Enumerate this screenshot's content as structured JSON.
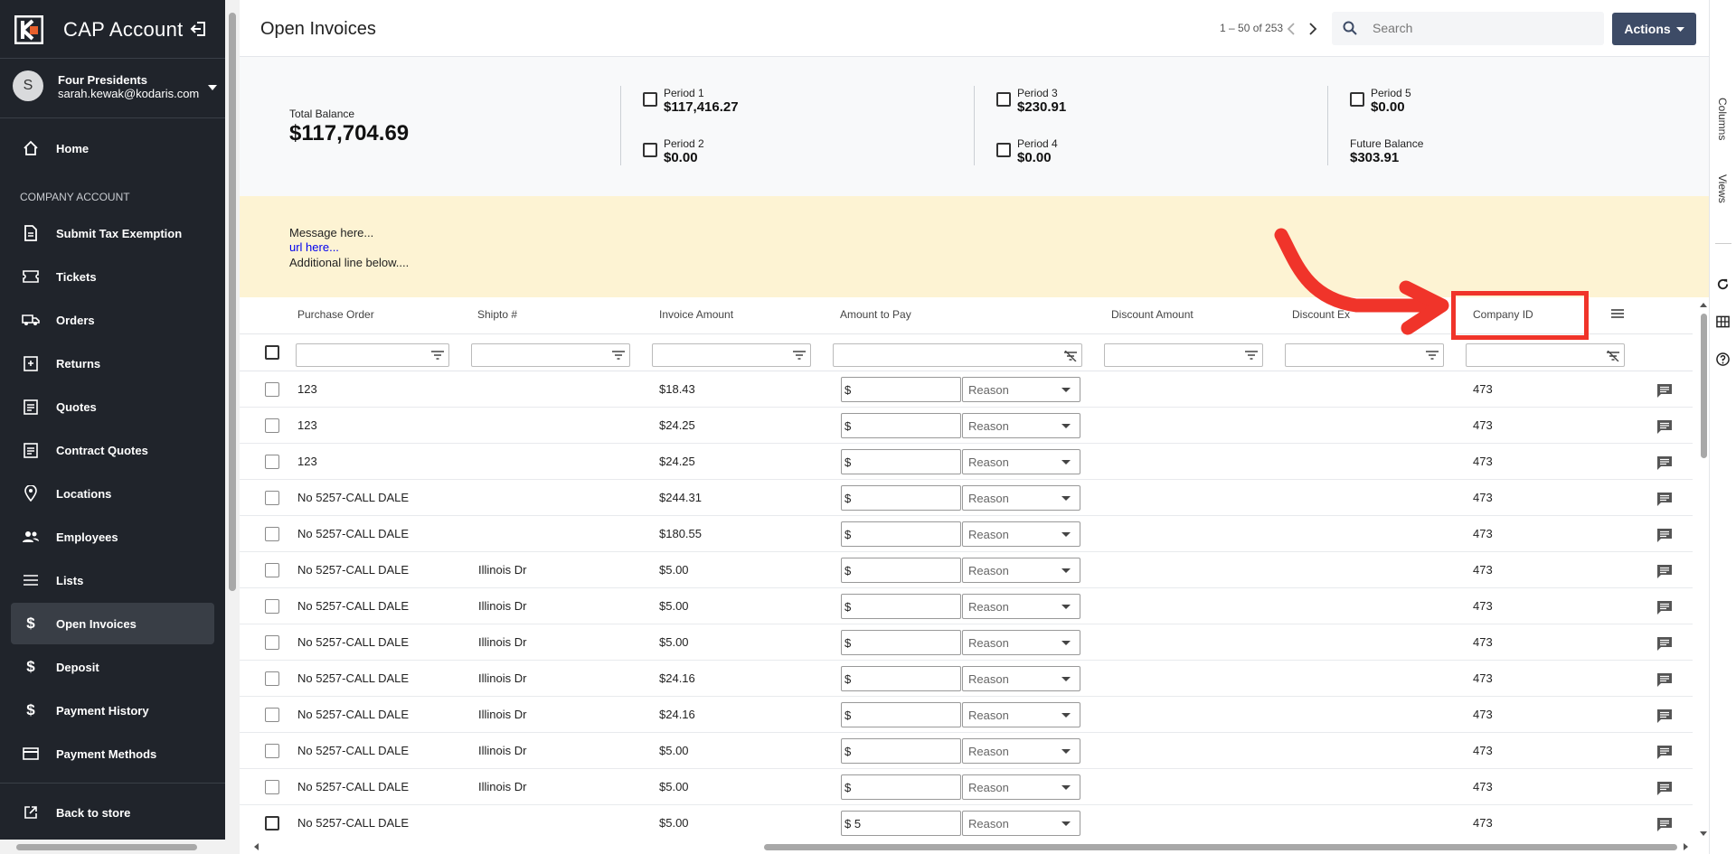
{
  "sidebar": {
    "brand": "CAP Account",
    "account": {
      "initial": "S",
      "name": "Four Presidents",
      "email": "sarah.kewak@kodaris.com"
    },
    "section_label": "COMPANY ACCOUNT",
    "items": [
      {
        "label": "Home",
        "icon": "home-icon"
      },
      {
        "label": "Submit Tax Exemption",
        "icon": "document-icon"
      },
      {
        "label": "Tickets",
        "icon": "ticket-icon"
      },
      {
        "label": "Orders",
        "icon": "truck-icon"
      },
      {
        "label": "Returns",
        "icon": "return-icon"
      },
      {
        "label": "Quotes",
        "icon": "quote-icon"
      },
      {
        "label": "Contract Quotes",
        "icon": "contract-icon"
      },
      {
        "label": "Locations",
        "icon": "location-icon"
      },
      {
        "label": "Employees",
        "icon": "employees-icon"
      },
      {
        "label": "Lists",
        "icon": "list-icon"
      },
      {
        "label": "Open Invoices",
        "icon": "dollar-icon",
        "active": true
      },
      {
        "label": "Deposit",
        "icon": "dollar-icon"
      },
      {
        "label": "Payment History",
        "icon": "dollar-icon"
      },
      {
        "label": "Payment Methods",
        "icon": "credit-card-icon"
      }
    ],
    "back_to_store": "Back to store"
  },
  "header": {
    "title": "Open Invoices",
    "pager": "1 – 50 of 253",
    "search_placeholder": "Search",
    "actions_label": "Actions"
  },
  "summary": {
    "total_label": "Total Balance",
    "total_value": "$117,704.69",
    "periods": [
      {
        "label": "Period 1",
        "value": "$117,416.27"
      },
      {
        "label": "Period 2",
        "value": "$0.00"
      },
      {
        "label": "Period 3",
        "value": "$230.91"
      },
      {
        "label": "Period 4",
        "value": "$0.00"
      },
      {
        "label": "Period 5",
        "value": "$0.00"
      }
    ],
    "future_label": "Future Balance",
    "future_value": "$303.91"
  },
  "banner": {
    "line1": "Message here...",
    "link": "url here...",
    "line3": "Additional line below...."
  },
  "right_panel": {
    "columns_tab": "Columns",
    "views_tab": "Views"
  },
  "grid": {
    "columns": [
      "Purchase Order",
      "Shipto #",
      "Invoice Amount",
      "Amount to Pay",
      "Discount Amount",
      "Discount Ex",
      "Company ID"
    ],
    "reason_placeholder": "Reason",
    "rows": [
      {
        "po": "123",
        "shipto": "",
        "amount": "$18.43",
        "pay": "$",
        "company": "473"
      },
      {
        "po": "123",
        "shipto": "",
        "amount": "$24.25",
        "pay": "$",
        "company": "473"
      },
      {
        "po": "123",
        "shipto": "",
        "amount": "$24.25",
        "pay": "$",
        "company": "473"
      },
      {
        "po": "No 5257-CALL DALE",
        "shipto": "",
        "amount": "$244.31",
        "pay": "$",
        "company": "473"
      },
      {
        "po": "No 5257-CALL DALE",
        "shipto": "",
        "amount": "$180.55",
        "pay": "$",
        "company": "473"
      },
      {
        "po": "No 5257-CALL DALE",
        "shipto": "Illinois Dr",
        "amount": "$5.00",
        "pay": "$",
        "company": "473"
      },
      {
        "po": "No 5257-CALL DALE",
        "shipto": "Illinois Dr",
        "amount": "$5.00",
        "pay": "$",
        "company": "473"
      },
      {
        "po": "No 5257-CALL DALE",
        "shipto": "Illinois Dr",
        "amount": "$5.00",
        "pay": "$",
        "company": "473"
      },
      {
        "po": "No 5257-CALL DALE",
        "shipto": "Illinois Dr",
        "amount": "$24.16",
        "pay": "$",
        "company": "473"
      },
      {
        "po": "No 5257-CALL DALE",
        "shipto": "Illinois Dr",
        "amount": "$24.16",
        "pay": "$",
        "company": "473"
      },
      {
        "po": "No 5257-CALL DALE",
        "shipto": "Illinois Dr",
        "amount": "$5.00",
        "pay": "$",
        "company": "473"
      },
      {
        "po": "No 5257-CALL DALE",
        "shipto": "Illinois Dr",
        "amount": "$5.00",
        "pay": "$",
        "company": "473"
      },
      {
        "po": "No 5257-CALL DALE",
        "shipto": "",
        "amount": "$5.00",
        "pay": "$ 5",
        "company": "473"
      }
    ]
  },
  "colors": {
    "sidebar_bg": "#20242b",
    "actions_bg": "#3d4b66",
    "banner_bg": "#fdf3d3",
    "highlight": "#f0342a"
  }
}
